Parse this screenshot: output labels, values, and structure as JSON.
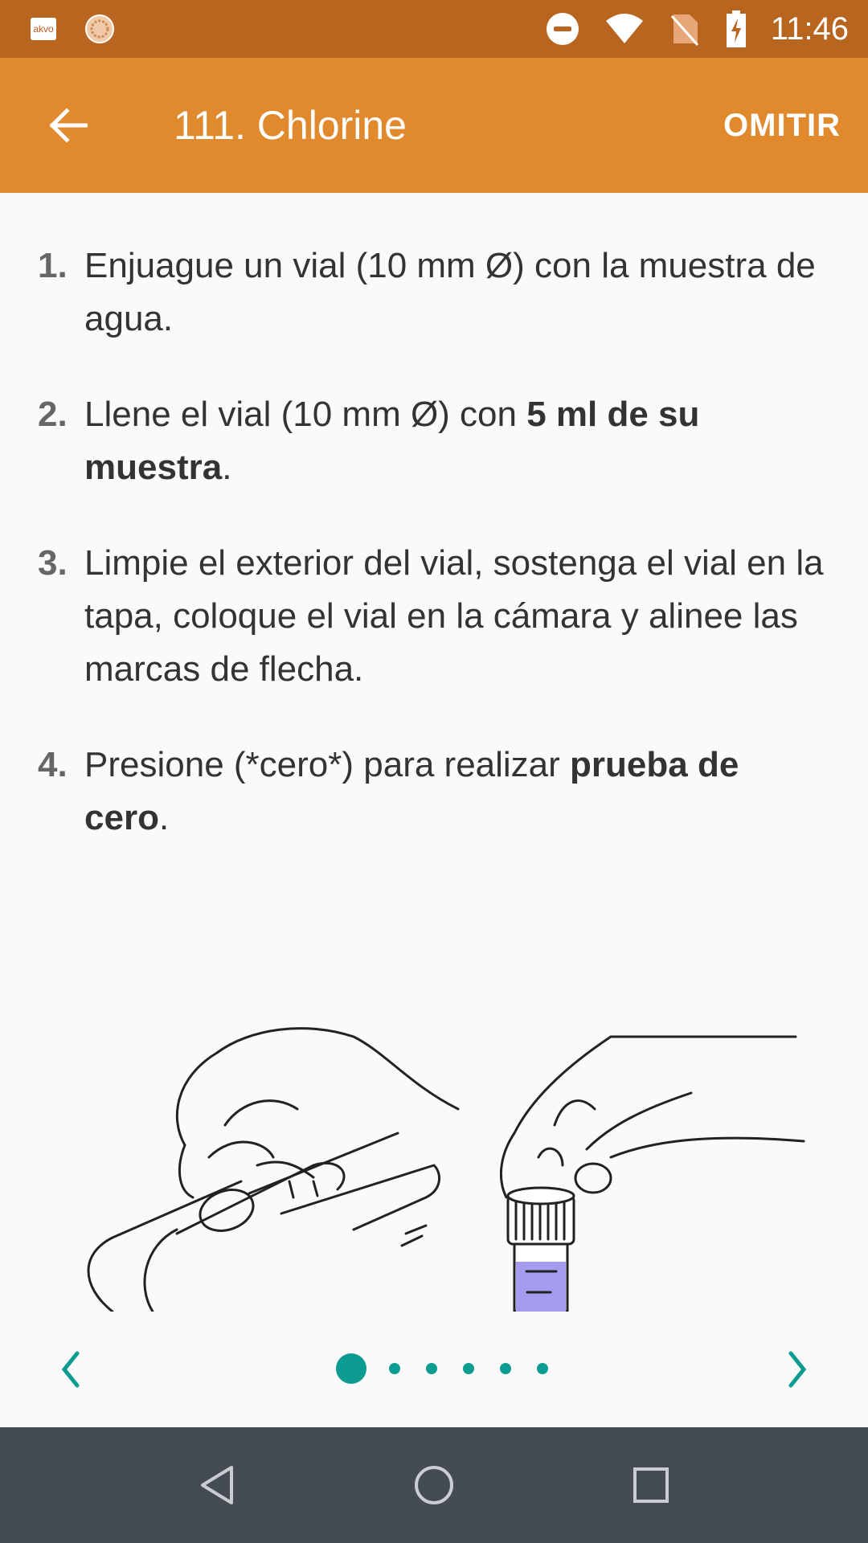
{
  "status_bar": {
    "app_badge": "akvo",
    "time": "11:46"
  },
  "app_bar": {
    "title": "111. Chlorine",
    "skip_label": "OMITIR"
  },
  "steps": [
    {
      "num": "1.",
      "parts": [
        {
          "t": "Enjuague un vial (10 mm Ø) con la muestra de agua.",
          "bold": false
        }
      ]
    },
    {
      "num": "2.",
      "parts": [
        {
          "t": "Llene el vial (10 mm Ø) con ",
          "bold": false
        },
        {
          "t": "5 ml de su muestra",
          "bold": true
        },
        {
          "t": ".",
          "bold": false
        }
      ]
    },
    {
      "num": "3.",
      "parts": [
        {
          "t": "Limpie el exterior del vial, sostenga el vial en la tapa, coloque el vial en la cámara y alinee las marcas de flecha.",
          "bold": false
        }
      ]
    },
    {
      "num": "4.",
      "parts": [
        {
          "t": "Presione (*cero*) para realizar ",
          "bold": false
        },
        {
          "t": "prueba de cero",
          "bold": true
        },
        {
          "t": ".",
          "bold": false
        }
      ]
    }
  ],
  "pager": {
    "page_count": 6,
    "current_page": 1
  },
  "colors": {
    "status_bar": "#b8651f",
    "app_bar": "#e0892d",
    "accent": "#0d9c92",
    "nav_bar": "#444b52",
    "sample_liquid": "#a59cf0"
  },
  "icons": {
    "back": "arrow-left-icon",
    "prev": "chevron-left-icon",
    "next": "chevron-right-icon",
    "nav_back": "triangle-back-icon",
    "nav_home": "circle-home-icon",
    "nav_recents": "square-recents-icon"
  }
}
